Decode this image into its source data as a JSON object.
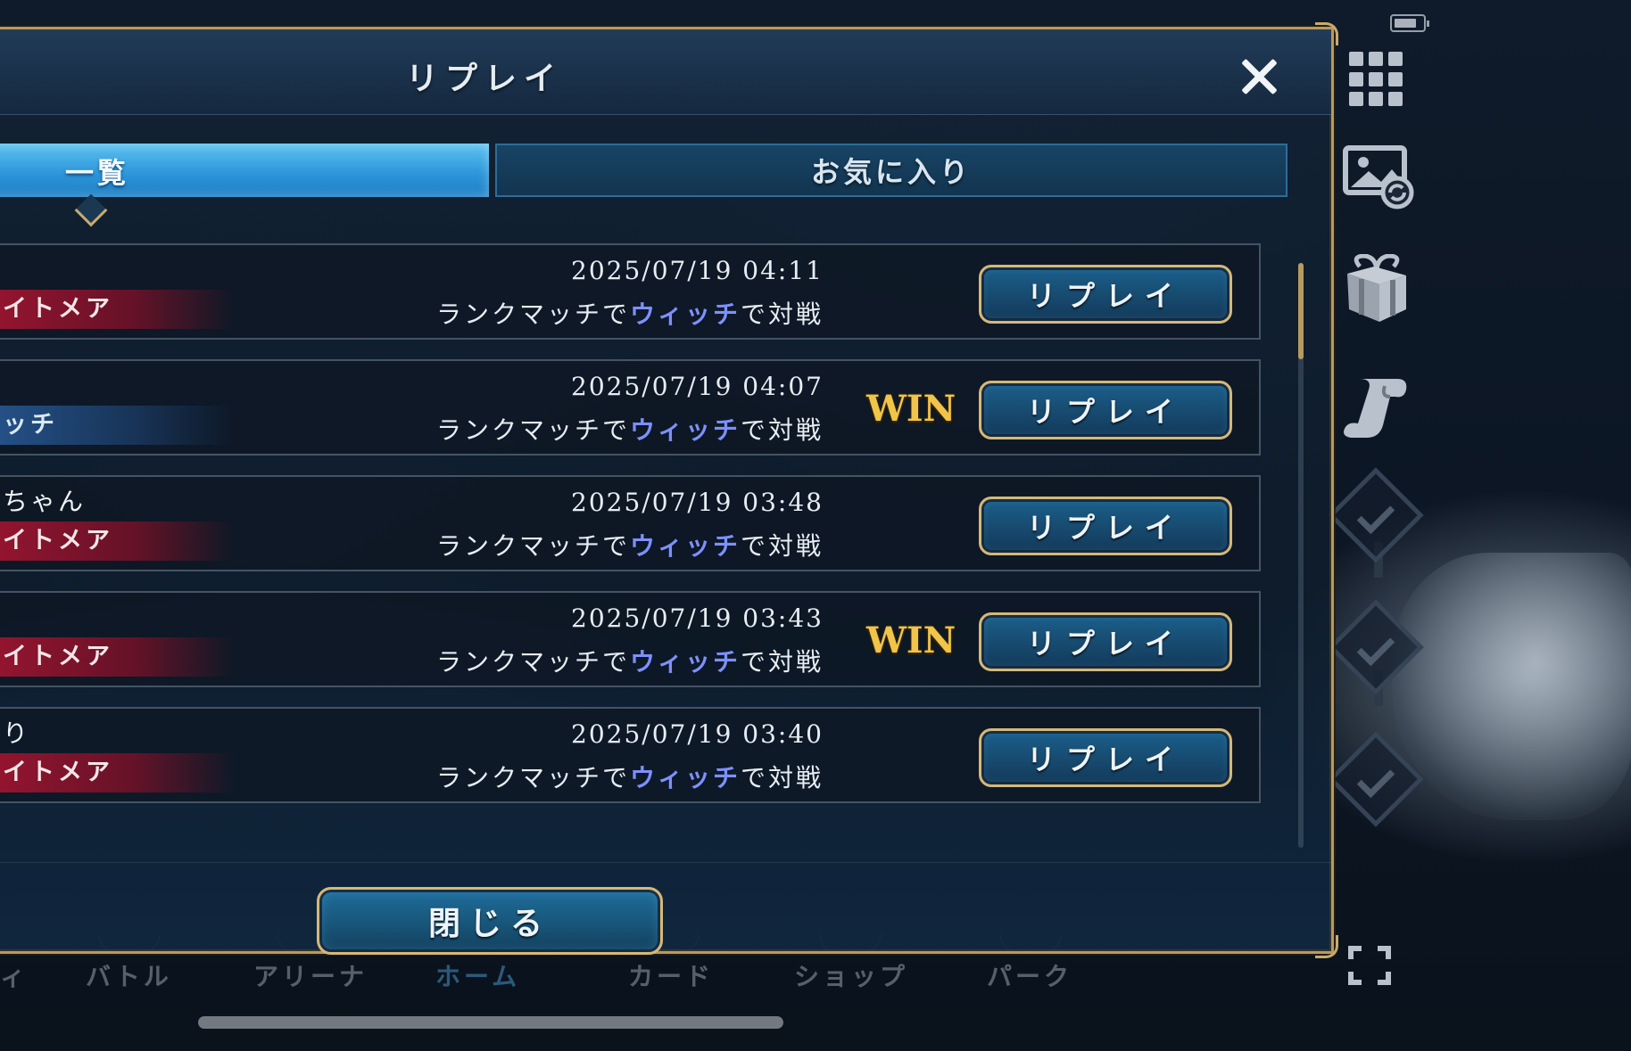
{
  "dialog": {
    "title": "リプレイ",
    "close_icon": "close-icon",
    "footer_close_label": "閉じる"
  },
  "tabs": [
    {
      "label": "一覧",
      "active": true
    },
    {
      "label": "お気に入り",
      "active": false
    }
  ],
  "replays": [
    {
      "name": "",
      "class_banner": "イトメア",
      "banner_color": "red",
      "date": "2025/07/19 04:11",
      "desc_pre": "ランクマッチで",
      "desc_class": "ウィッチ",
      "desc_post": "で対戦",
      "result": "",
      "button": "リプレイ"
    },
    {
      "name": "",
      "class_banner": "ッチ",
      "banner_color": "blue",
      "date": "2025/07/19 04:07",
      "desc_pre": "ランクマッチで",
      "desc_class": "ウィッチ",
      "desc_post": "で対戦",
      "result": "WIN",
      "button": "リプレイ"
    },
    {
      "name": "ちゃん",
      "class_banner": "イトメア",
      "banner_color": "red",
      "date": "2025/07/19 03:48",
      "desc_pre": "ランクマッチで",
      "desc_class": "ウィッチ",
      "desc_post": "で対戦",
      "result": "",
      "button": "リプレイ"
    },
    {
      "name": "",
      "class_banner": "イトメア",
      "banner_color": "red",
      "date": "2025/07/19 03:43",
      "desc_pre": "ランクマッチで",
      "desc_class": "ウィッチ",
      "desc_post": "で対戦",
      "result": "WIN",
      "button": "リプレイ"
    },
    {
      "name": "り",
      "class_banner": "イトメア",
      "banner_color": "red",
      "date": "2025/07/19 03:40",
      "desc_pre": "ランクマッチで",
      "desc_class": "ウィッチ",
      "desc_post": "で対戦",
      "result": "",
      "button": "リプレイ"
    }
  ],
  "bottom_nav": {
    "items": [
      "ィ",
      "バトル",
      "アリーナ",
      "ホーム",
      "カード",
      "ショップ",
      "パーク"
    ],
    "active": "ホーム"
  },
  "sidebar": {
    "icons": [
      "battery-icon",
      "menu-grid-icon",
      "image-swap-icon",
      "gift-icon",
      "scroll-icon",
      "mission-check-icon",
      "mission-check-icon",
      "mission-check-icon",
      "fullscreen-icon"
    ]
  },
  "colors": {
    "accent_gold": "#d5b878",
    "tab_active": "#2b93d8",
    "class_highlight": "#7d90ff",
    "win": "#f1c44a"
  }
}
